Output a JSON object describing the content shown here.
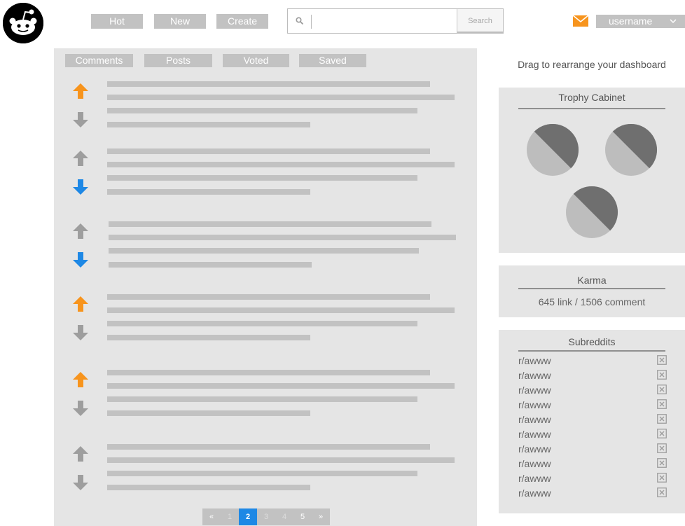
{
  "nav": {
    "hot": "Hot",
    "new": "New",
    "create": "Create"
  },
  "search": {
    "placeholder": "",
    "button": "Search"
  },
  "user": {
    "name": "username"
  },
  "tabs": [
    {
      "label": "Comments",
      "active": false
    },
    {
      "label": "Posts",
      "active": false
    },
    {
      "label": "Voted",
      "active": true
    },
    {
      "label": "Saved",
      "active": false
    }
  ],
  "votes": [
    {
      "vote": "up"
    },
    {
      "vote": "down"
    },
    {
      "vote": "down"
    },
    {
      "vote": "up"
    },
    {
      "vote": "up"
    },
    {
      "vote": "none"
    }
  ],
  "pagination": {
    "first": "«",
    "pages": [
      "1",
      "2",
      "3",
      "4",
      "5"
    ],
    "current": "2",
    "last": "»"
  },
  "sidebar": {
    "drag_hint": "Drag to rearrange your dashboard",
    "trophy_title": "Trophy Cabinet",
    "karma_title": "Karma",
    "karma_value": "645 link / 1506 comment",
    "subreddits_title": "Subreddits",
    "subreddits": [
      "r/awww",
      "r/awww",
      "r/awww",
      "r/awww",
      "r/awww",
      "r/awww",
      "r/awww",
      "r/awww",
      "r/awww",
      "r/awww"
    ]
  },
  "colors": {
    "upvote": "#f7941d",
    "downvote": "#1e88e5",
    "neutral_arrow": "#9e9e9e",
    "mail": "#f7941d",
    "active_tab": "#1e88e5",
    "placeholder_bar": "#c2c2c2"
  }
}
